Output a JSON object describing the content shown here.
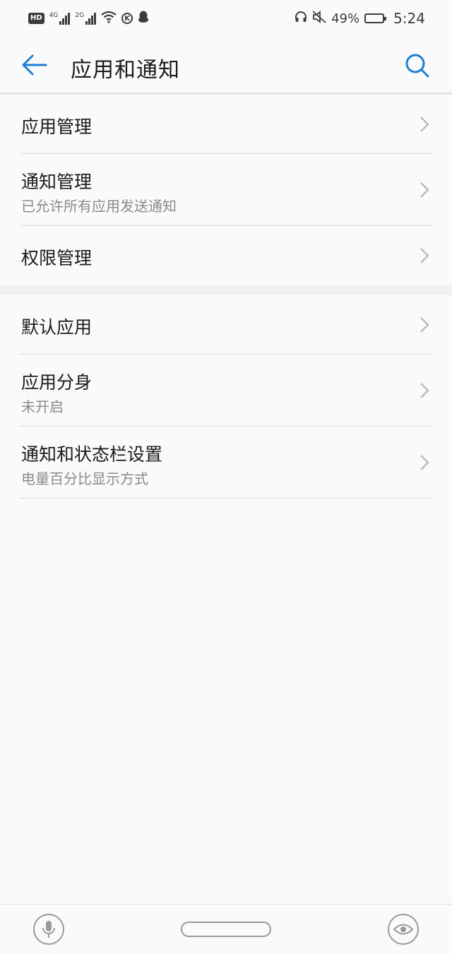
{
  "status_bar": {
    "hd_label": "HD",
    "net1_gen": "4G",
    "net2_gen": "2G",
    "k_label": "K",
    "battery_percent": "49%",
    "battery_level": 0.49,
    "time": "5:24",
    "icons": [
      "hd-icon",
      "signal-4g-icon",
      "signal-2g-icon",
      "wifi-icon",
      "k-app-icon",
      "qq-icon",
      "headset-icon",
      "mute-icon",
      "battery-icon"
    ]
  },
  "app_bar": {
    "title": "应用和通知",
    "back_icon": "arrow-back-icon",
    "search_icon": "search-icon",
    "accent_color": "#1f7fd1"
  },
  "groups": [
    {
      "items": [
        {
          "label": "应用管理",
          "sublabel": ""
        },
        {
          "label": "通知管理",
          "sublabel": "已允许所有应用发送通知"
        },
        {
          "label": "权限管理",
          "sublabel": ""
        }
      ]
    },
    {
      "items": [
        {
          "label": "默认应用",
          "sublabel": ""
        },
        {
          "label": "应用分身",
          "sublabel": "未开启"
        },
        {
          "label": "通知和状态栏设置",
          "sublabel": "电量百分比显示方式"
        }
      ]
    }
  ],
  "nav_bar": {
    "icons": [
      "microphone-icon",
      "home-pill",
      "eye-icon"
    ]
  }
}
